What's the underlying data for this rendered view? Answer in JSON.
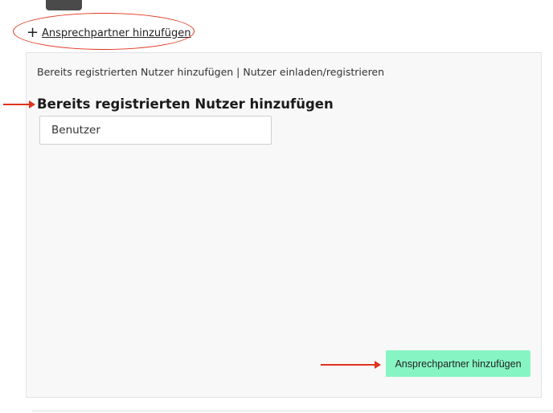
{
  "header": {
    "add_contact_link": "Ansprechpartner hinzufügen",
    "plus_symbol": "+"
  },
  "panel": {
    "tab_registered": "Bereits registrierten Nutzer hinzufügen",
    "tab_separator": " | ",
    "tab_invite": "Nutzer einladen/registrieren",
    "section_title": "Bereits registrierten Nutzer hinzufügen",
    "user_field": {
      "placeholder": "Benutzer",
      "value": ""
    },
    "submit_label": "Ansprechpartner hinzufügen"
  },
  "colors": {
    "annotation_red": "#e0331c",
    "submit_green": "#86f5c3",
    "panel_bg": "#f8f8f8"
  },
  "icons": {
    "top_thumbnail": "image-thumbnail-icon",
    "add": "plus-icon"
  }
}
